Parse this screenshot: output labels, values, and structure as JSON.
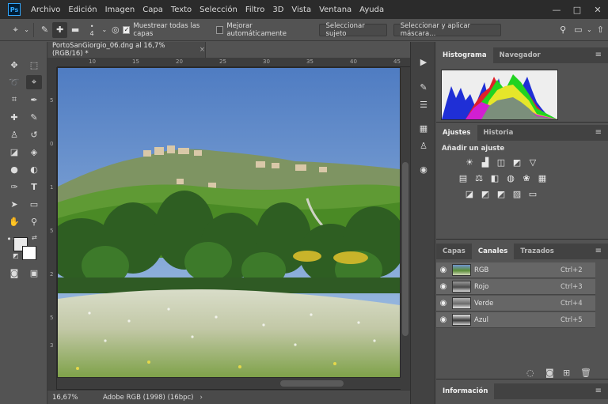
{
  "menubar": {
    "logo": "Ps",
    "items": [
      "Archivo",
      "Edición",
      "Imagen",
      "Capa",
      "Texto",
      "Selección",
      "Filtro",
      "3D",
      "Vista",
      "Ventana",
      "Ayuda"
    ],
    "window_controls": [
      "—",
      "□",
      "✕"
    ]
  },
  "options": {
    "brush_size": "4",
    "sample_all_layers": "Muestrear todas las capas",
    "auto_enhance": "Mejorar automáticamente",
    "select_subject": "Seleccionar sujeto",
    "select_and_mask": "Seleccionar y aplicar máscara..."
  },
  "document": {
    "tab_title": "PortoSanGiorgio_06.dng al 16,7% (RGB/16) *",
    "tab_close": "×",
    "ruler_h": [
      "10",
      "15",
      "20",
      "25",
      "30",
      "35",
      "40",
      "45"
    ],
    "ruler_v": [
      "5",
      "0",
      "1",
      "5",
      "2",
      "5",
      "3"
    ],
    "zoom": "16,67%",
    "profile": "Adobe RGB (1998) (16bpc)"
  },
  "panels": {
    "histogram": {
      "tabs": [
        "Histograma",
        "Navegador"
      ]
    },
    "adjustments": {
      "tabs": [
        "Ajustes",
        "Historia"
      ],
      "heading": "Añadir un ajuste"
    },
    "channels": {
      "tabs": [
        "Capas",
        "Canales",
        "Trazados"
      ],
      "rows": [
        {
          "name": "RGB",
          "shortcut": "Ctrl+2"
        },
        {
          "name": "Rojo",
          "shortcut": "Ctrl+3"
        },
        {
          "name": "Verde",
          "shortcut": "Ctrl+4"
        },
        {
          "name": "Azul",
          "shortcut": "Ctrl+5"
        }
      ]
    },
    "info": {
      "tabs": [
        "Información"
      ]
    },
    "menu_icon": "≡"
  }
}
